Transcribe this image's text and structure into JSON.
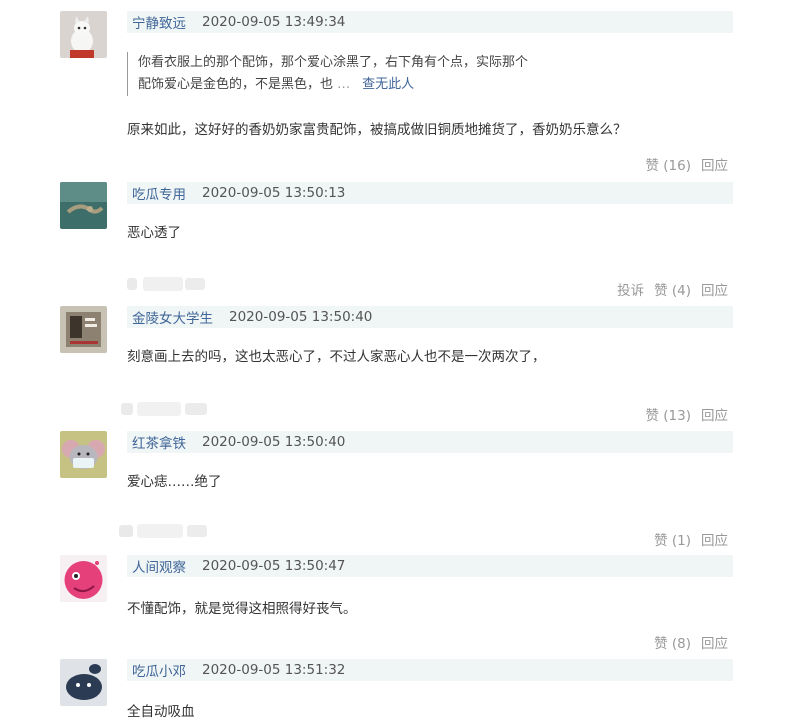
{
  "comments": [
    {
      "user": "宁静致远",
      "time": "2020-09-05 13:49:34",
      "quote_line1": "你看衣服上的那个配饰，那个爱心涂黑了，右下角有个点，实际那个",
      "quote_line2": "配饰爱心是金色的，不是黑色，也",
      "quote_more": "…",
      "quote_link": "查无此人",
      "text": "原来如此，这好好的香奶奶家富贵配饰，被搞成做旧铜质地摊货了，香奶奶乐意么？",
      "like": "赞 (16)",
      "reply": "回应"
    },
    {
      "user": "吃瓜专用",
      "time": "2020-09-05 13:50:13",
      "text": "恶心透了",
      "report": "投诉",
      "like": "赞 (4)",
      "reply": "回应"
    },
    {
      "user": "金陵女大学生",
      "time": "2020-09-05 13:50:40",
      "text": "刻意画上去的吗，这也太恶心了，不过人家恶心人也不是一次两次了，",
      "like": "赞 (13)",
      "reply": "回应"
    },
    {
      "user": "红茶拿铁",
      "time": "2020-09-05 13:50:40",
      "text": "爱心痣……绝了",
      "like": "赞 (1)",
      "reply": "回应"
    },
    {
      "user": "人间观察",
      "time": "2020-09-05 13:50:47",
      "text": "不懂配饰，就是觉得这相照得好丧气。",
      "like": "赞 (8)",
      "reply": "回应"
    },
    {
      "user": "吃瓜小邓",
      "time": "2020-09-05 13:51:32",
      "text": "全自动吸血"
    }
  ],
  "colors": {
    "username": "#406599",
    "meta_bg": "#f0f6f5",
    "muted": "#999999"
  }
}
